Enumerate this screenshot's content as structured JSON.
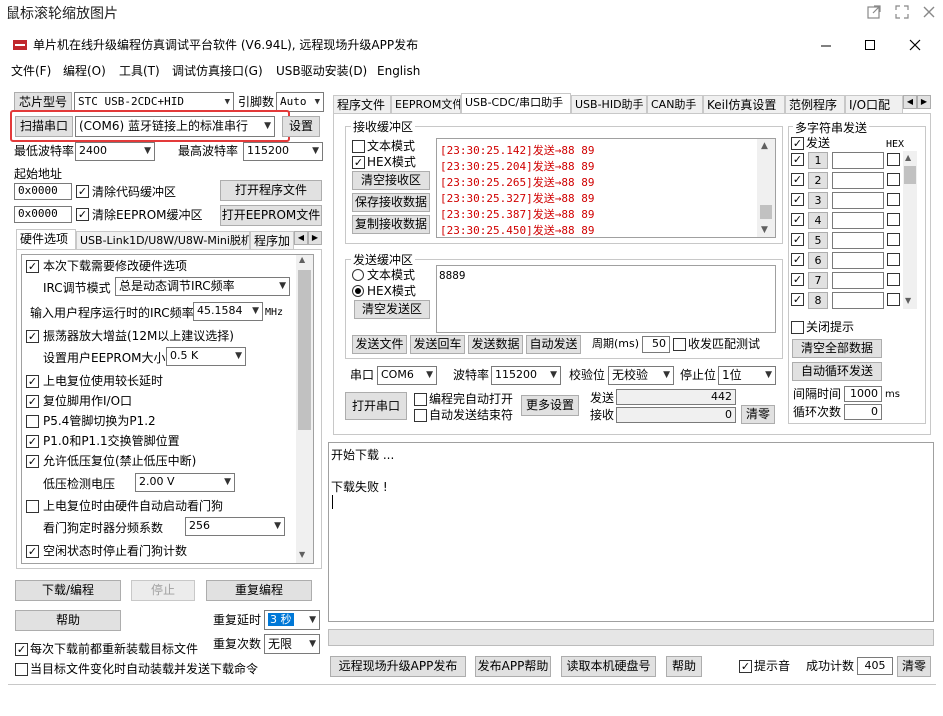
{
  "outer": {
    "title": "鼠标滚轮缩放图片"
  },
  "window": {
    "title": "单片机在线升级编程仿真调试平台软件 (V6.94L), 远程现场升级APP发布"
  },
  "menu": [
    "文件(F)",
    "编程(O)",
    "工具(T)",
    "调试仿真接口(G)",
    "USB驱动安装(D)",
    "English"
  ],
  "left": {
    "chip_label": "芯片型号",
    "chip_value": "STC USB-2CDC+HID",
    "pin_label": "引脚数",
    "pin_value": "Auto",
    "scan_button": "扫描串口",
    "port_value": "(COM6) 蓝牙链接上的标准串行",
    "settings_button": "设置",
    "min_baud_label": "最低波特率",
    "min_baud_value": "2400",
    "max_baud_label": "最高波特率",
    "max_baud_value": "115200",
    "start_addr_label": "起始地址",
    "addr1": "0x0000",
    "clear_code_label": "清除代码缓冲区",
    "open_prog_button": "打开程序文件",
    "addr2": "0x0000",
    "clear_eeprom_label": "清除EEPROM缓冲区",
    "open_eeprom_button": "打开EEPROM文件",
    "tabs": [
      "硬件选项",
      "USB-Link1D/U8W/U8W-Mini脱机",
      "程序加"
    ],
    "options": {
      "opt_modify": "本次下载需要修改硬件选项",
      "irc_mode_label": "IRC调节模式",
      "irc_mode_value": "总是动态调节IRC频率",
      "irc_freq_label": "输入用户程序运行时的IRC频率",
      "irc_freq_value": "45.1584",
      "irc_freq_unit": "MHz",
      "opt_osc_gain": "振荡器放大增益(12M以上建议选择)",
      "eeprom_size_label": "设置用户EEPROM大小",
      "eeprom_size_value": "0.5 K",
      "opt_reset_delay": "上电复位使用较长延时",
      "opt_reset_io": "复位脚用作I/O口",
      "opt_p54": "P5.4管脚切换为P1.2",
      "opt_p10": "P1.0和P1.1交换管脚位置",
      "opt_lvr": "允许低压复位(禁止低压中断)",
      "lvd_label": "低压检测电压",
      "lvd_value": "2.00 V",
      "opt_wdt": "上电复位时由硬件自动启动看门狗",
      "wdt_div_label": "看门狗定时器分频系数",
      "wdt_div_value": "256",
      "opt_idle_wdt": "空闲状态时停止看门狗计数"
    },
    "download_button": "下载/编程",
    "stop_button": "停止",
    "reprogram_button": "重复编程",
    "help_button": "帮助",
    "repeat_delay_label": "重复延时",
    "repeat_delay_value": "3 秒",
    "repeat_count_label": "重复次数",
    "repeat_count_value": "无限",
    "reload_label": "每次下载前都重新装载目标文件",
    "autosend_label": "当目标文件变化时自动装载并发送下载命令"
  },
  "right": {
    "tabs": [
      "程序文件",
      "EEPROM文件",
      "USB-CDC/串口助手",
      "USB-HID助手",
      "CAN助手",
      "Keil仿真设置",
      "范例程序",
      "I/O口配"
    ],
    "recv_group": "接收缓冲区",
    "recv_text_mode": "文本模式",
    "recv_hex_mode": "HEX模式",
    "clear_recv_button": "清空接收区",
    "save_recv_button": "保存接收数据",
    "copy_recv_button": "复制接收数据",
    "recv_lines": [
      "[23:30:25.142]发送→88 89",
      "[23:30:25.204]发送→88 89",
      "[23:30:25.265]发送→88 89",
      "[23:30:25.327]发送→88 89",
      "[23:30:25.387]发送→88 89",
      "[23:30:25.450]发送→88 89"
    ],
    "send_group": "发送缓冲区",
    "send_text_mode": "文本模式",
    "send_hex_mode": "HEX模式",
    "clear_send_button": "清空发送区",
    "send_content": "8889",
    "send_file_button": "发送文件",
    "send_return_button": "发送回车",
    "send_data_button": "发送数据",
    "auto_send_button": "自动发送",
    "period_label": "周期(ms)",
    "period_value": "50",
    "match_label": "收发匹配测试",
    "port_label": "串口",
    "port_value": "COM6",
    "baud_label": "波特率",
    "baud_value": "115200",
    "parity_label": "校验位",
    "parity_value": "无校验",
    "stop_label": "停止位",
    "stop_value": "1位",
    "open_port_button": "打开串口",
    "auto_open_label": "编程完自动打开",
    "auto_end_label": "自动发送结束符",
    "more_settings_button": "更多设置",
    "send_count_label": "发送",
    "send_count": "442",
    "recv_count_label": "接收",
    "recv_count": "0",
    "clear_count_button": "清零",
    "multi_group": "多字符串发送",
    "multi_send_label": "发送",
    "hex_label": "HEX",
    "multi_rows": [
      "1",
      "2",
      "3",
      "4",
      "5",
      "6",
      "7",
      "8"
    ],
    "close_tip_label": "关闭提示",
    "clear_all_button": "清空全部数据",
    "auto_loop_button": "自动循环发送",
    "interval_label": "间隔时间",
    "interval_value": "1000",
    "interval_unit": "ms",
    "loop_count_label": "循环次数",
    "loop_count_value": "0"
  },
  "log": {
    "lines": [
      "开始下载 ...",
      "",
      "下载失败 !"
    ]
  },
  "bottom": {
    "publish_button": "远程现场升级APP发布",
    "publish_help_button": "发布APP帮助",
    "read_disk_button": "读取本机硬盘号",
    "help_button": "帮助",
    "beep_label": "提示音",
    "success_label": "成功计数",
    "success_value": "405",
    "clear_button": "清零"
  },
  "colors": {
    "highlight_border": "#e33a3a",
    "recv_text": "#d00000"
  }
}
